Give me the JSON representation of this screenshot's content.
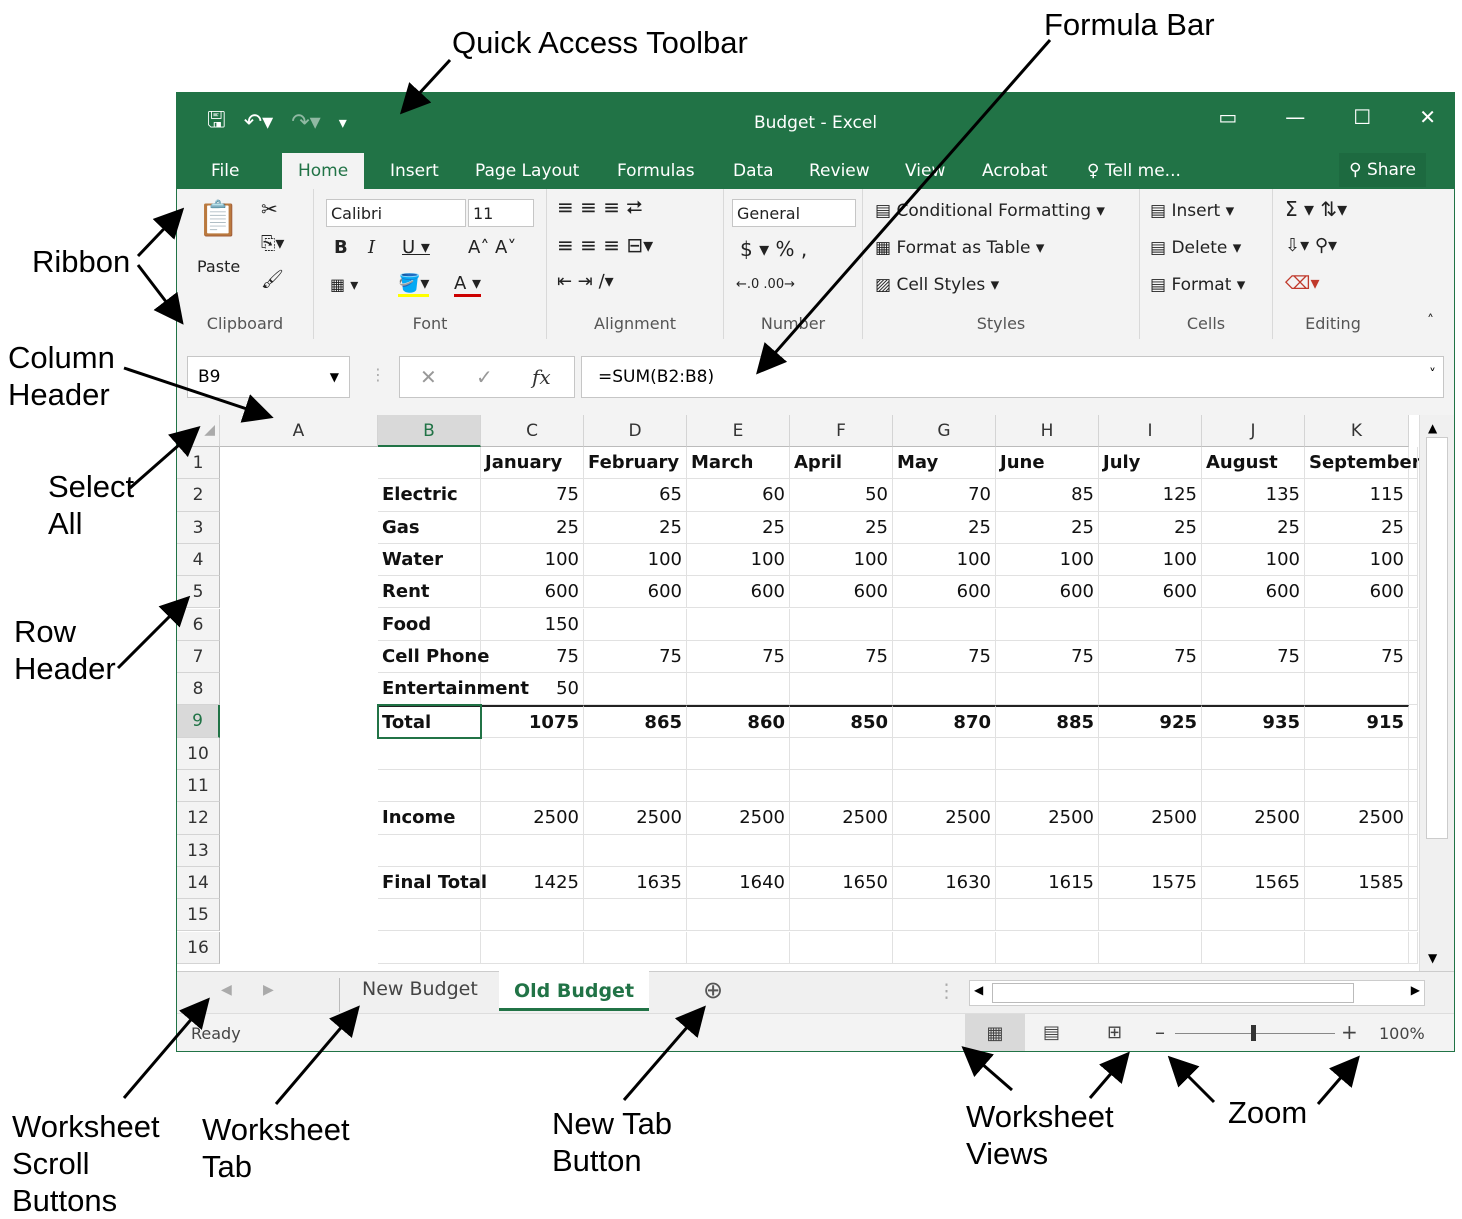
{
  "annotations": {
    "quick_access_toolbar": "Quick Access Toolbar",
    "formula_bar": "Formula Bar",
    "ribbon": "Ribbon",
    "column_header": [
      "Column",
      "Header"
    ],
    "select_all": [
      "Select",
      "All"
    ],
    "row_header": [
      "Row",
      "Header"
    ],
    "worksheet_scroll_buttons": [
      "Worksheet",
      "Scroll",
      "Buttons"
    ],
    "worksheet_tab": [
      "Worksheet",
      "Tab"
    ],
    "new_tab_button": [
      "New Tab",
      "Button"
    ],
    "worksheet_views": [
      "Worksheet",
      "Views"
    ],
    "zoom": "Zoom"
  },
  "window": {
    "title": "Budget - Excel",
    "accent": "#217346"
  },
  "ribbon_tabs": [
    "File",
    "Home",
    "Insert",
    "Page Layout",
    "Formulas",
    "Data",
    "Review",
    "View",
    "Acrobat",
    "Tell me...",
    "Share"
  ],
  "ribbon": {
    "paste": "Paste",
    "font_name": "Calibri",
    "font_size": "11",
    "number_format": "General",
    "conditional_formatting": "Conditional Formatting",
    "format_as_table": "Format as Table",
    "cell_styles": "Cell Styles",
    "insert": "Insert",
    "delete": "Delete",
    "format": "Format",
    "groups": [
      "Clipboard",
      "Font",
      "Alignment",
      "Number",
      "Styles",
      "Cells",
      "Editing"
    ]
  },
  "formula_bar": {
    "name_box": "B9",
    "formula": "=SUM(B2:B8)",
    "fx": "fx"
  },
  "columns": [
    "A",
    "B",
    "C",
    "D",
    "E",
    "F",
    "G",
    "H",
    "I",
    "J",
    "K"
  ],
  "rows": [
    [
      "",
      "January",
      "February",
      "March",
      "April",
      "May",
      "June",
      "July",
      "August",
      "September"
    ],
    [
      "Electric",
      "75",
      "65",
      "60",
      "50",
      "70",
      "85",
      "125",
      "135",
      "115"
    ],
    [
      "Gas",
      "25",
      "25",
      "25",
      "25",
      "25",
      "25",
      "25",
      "25",
      "25"
    ],
    [
      "Water",
      "100",
      "100",
      "100",
      "100",
      "100",
      "100",
      "100",
      "100",
      "100"
    ],
    [
      "Rent",
      "600",
      "600",
      "600",
      "600",
      "600",
      "600",
      "600",
      "600",
      "600"
    ],
    [
      "Food",
      "150",
      "",
      "",
      "",
      "",
      "",
      "",
      "",
      ""
    ],
    [
      "Cell Phone",
      "75",
      "75",
      "75",
      "75",
      "75",
      "75",
      "75",
      "75",
      "75"
    ],
    [
      "Entertainment",
      "50",
      "",
      "",
      "",
      "",
      "",
      "",
      "",
      ""
    ],
    [
      "Total",
      "1075",
      "865",
      "860",
      "850",
      "870",
      "885",
      "925",
      "935",
      "915"
    ],
    [
      "",
      "",
      "",
      "",
      "",
      "",
      "",
      "",
      "",
      ""
    ],
    [
      "",
      "",
      "",
      "",
      "",
      "",
      "",
      "",
      "",
      ""
    ],
    [
      "Income",
      "2500",
      "2500",
      "2500",
      "2500",
      "2500",
      "2500",
      "2500",
      "2500",
      "2500"
    ],
    [
      "",
      "",
      "",
      "",
      "",
      "",
      "",
      "",
      "",
      ""
    ],
    [
      "Final Total",
      "1425",
      "1635",
      "1640",
      "1650",
      "1630",
      "1615",
      "1575",
      "1565",
      "1585"
    ],
    [
      "",
      "",
      "",
      "",
      "",
      "",
      "",
      "",
      "",
      ""
    ],
    [
      "",
      "",
      "",
      "",
      "",
      "",
      "",
      "",
      "",
      ""
    ]
  ],
  "sheets": [
    "New Budget",
    "Old Budget"
  ],
  "active_sheet": "Old Budget",
  "status": {
    "ready": "Ready",
    "zoom": "100%"
  }
}
